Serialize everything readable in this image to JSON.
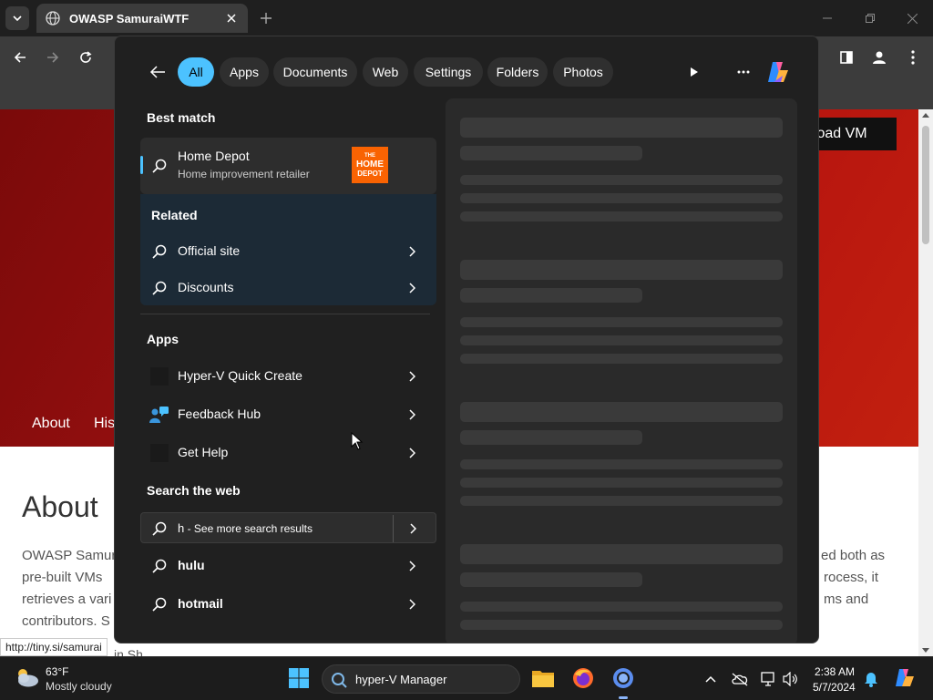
{
  "browser": {
    "tab_title": "OWASP SamuraiWTF",
    "status_url": "http://tiny.si/samurai"
  },
  "webpage": {
    "download_button": "nload VM",
    "nav": [
      "About",
      "His"
    ],
    "about_heading": "About",
    "text_left": [
      "OWASP Samur",
      "pre-built VMs",
      "retrieves a vari",
      "contributors. S"
    ],
    "text_right": [
      "ed both as",
      "rocess, it",
      "ms and"
    ],
    "bottom_text": "in Sh"
  },
  "search_flyout": {
    "filters": [
      "All",
      "Apps",
      "Documents",
      "Web",
      "Settings",
      "Folders",
      "Photos"
    ],
    "active_filter": "All",
    "best_match_heading": "Best match",
    "best_match": {
      "title": "Home Depot",
      "subtitle": "Home improvement retailer",
      "logo_text": [
        "THE",
        "HOME",
        "DEPOT"
      ]
    },
    "related_heading": "Related",
    "related": [
      "Official site",
      "Discounts"
    ],
    "apps_heading": "Apps",
    "apps": [
      "Hyper-V Quick Create",
      "Feedback Hub",
      "Get Help"
    ],
    "web_heading": "Search the web",
    "web_main": {
      "query": "h",
      "suffix": " - See more search results"
    },
    "web_suggestions": [
      "hulu",
      "hotmail"
    ]
  },
  "taskbar": {
    "weather_temp": "63°F",
    "weather_desc": "Mostly cloudy",
    "search_text": "hyper-V Manager",
    "time": "2:38 AM",
    "date": "5/7/2024"
  },
  "colors": {
    "accent": "#4cc2ff",
    "hero_red": "#a31212",
    "home_depot_orange": "#f96302"
  }
}
